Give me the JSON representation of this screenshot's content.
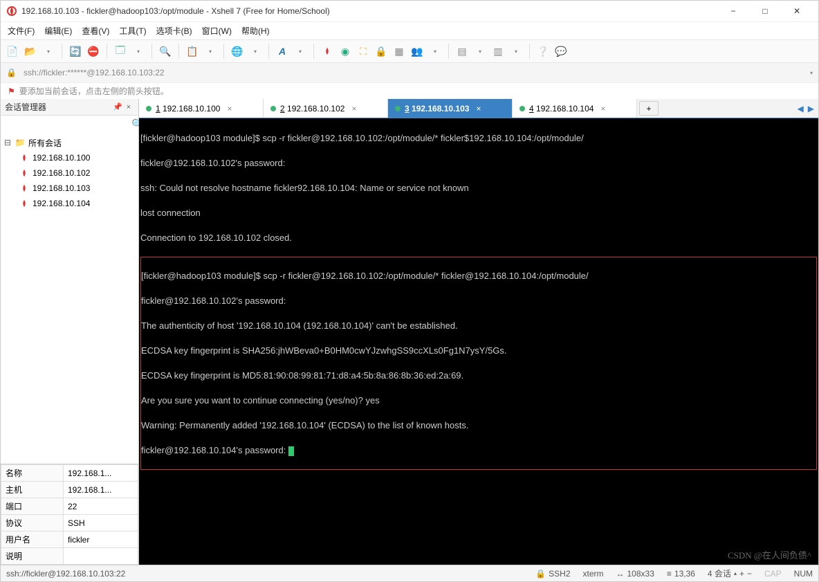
{
  "titlebar": {
    "title": "192.168.10.103 - fickler@hadoop103:/opt/module - Xshell 7 (Free for Home/School)"
  },
  "menubar": {
    "file": "文件(F)",
    "edit": "编辑(E)",
    "view": "查看(V)",
    "tools": "工具(T)",
    "tabs": "选项卡(B)",
    "window": "窗口(W)",
    "help": "帮助(H)"
  },
  "addressbar": {
    "url": "ssh://fickler:******@192.168.10.103:22"
  },
  "hintbar": {
    "text": "要添加当前会话，点击左侧的箭头按钮。"
  },
  "sidebar": {
    "title": "会话管理器",
    "search_placeholder": "",
    "root": "所有会话",
    "items": [
      {
        "label": "192.168.10.100"
      },
      {
        "label": "192.168.10.102"
      },
      {
        "label": "192.168.10.103"
      },
      {
        "label": "192.168.10.104"
      }
    ]
  },
  "props": {
    "name_k": "名称",
    "name_v": "192.168.1...",
    "host_k": "主机",
    "host_v": "192.168.1...",
    "port_k": "端口",
    "port_v": "22",
    "proto_k": "协议",
    "proto_v": "SSH",
    "user_k": "用户名",
    "user_v": "fickler",
    "desc_k": "说明",
    "desc_v": ""
  },
  "tabs": [
    {
      "num": "1",
      "label": "192.168.10.100",
      "active": false
    },
    {
      "num": "2",
      "label": "192.168.10.102",
      "active": false
    },
    {
      "num": "3",
      "label": "192.168.10.103",
      "active": true
    },
    {
      "num": "4",
      "label": "192.168.10.104",
      "active": false
    }
  ],
  "terminal": {
    "l0": "[fickler@hadoop103 module]$ scp -r fickler@192.168.10.102:/opt/module/* fickler$192.168.10.104:/opt/module/",
    "l1": "fickler@192.168.10.102's password: ",
    "l2": "ssh: Could not resolve hostname fickler92.168.10.104: Name or service not known",
    "l3": "lost connection",
    "l4": "Connection to 192.168.10.102 closed.",
    "l5": "[fickler@hadoop103 module]$ scp -r fickler@192.168.10.102:/opt/module/* fickler@192.168.10.104:/opt/module/",
    "l6": "fickler@192.168.10.102's password: ",
    "l7": "The authenticity of host '192.168.10.104 (192.168.10.104)' can't be established.",
    "l8": "ECDSA key fingerprint is SHA256:jhWBeva0+B0HM0cwYJzwhgSS9ccXLs0Fg1N7ysY/5Gs.",
    "l9": "ECDSA key fingerprint is MD5:81:90:08:99:81:71:d8:a4:5b:8a:86:8b:36:ed:2a:69.",
    "l10": "Are you sure you want to continue connecting (yes/no)? yes",
    "l11": "Warning: Permanently added '192.168.10.104' (ECDSA) to the list of known hosts.",
    "l12": "fickler@192.168.10.104's password: "
  },
  "statusbar": {
    "url": "ssh://fickler@192.168.10.103:22",
    "proto": "SSH2",
    "term": "xterm",
    "size": "108x33",
    "pos": "13,36",
    "sess": "4 会话",
    "cap": "CAP",
    "num": "NUM"
  },
  "watermark": "CSDN @在人间负债^"
}
